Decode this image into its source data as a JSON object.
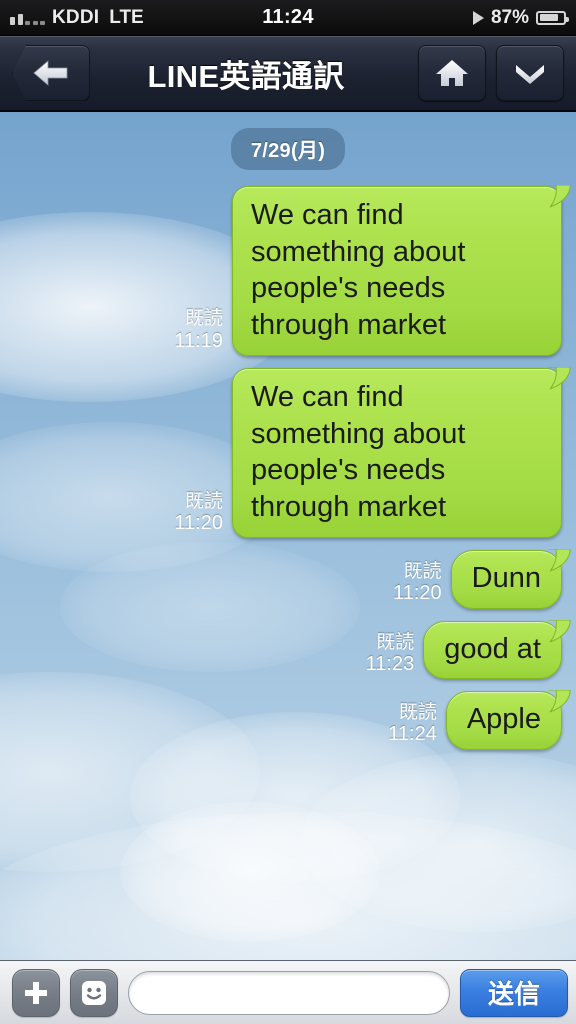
{
  "status_bar": {
    "signal_icon": "signal-bars-icon",
    "carrier": "KDDI",
    "network": "LTE",
    "time": "11:24",
    "play_icon": "play-triangle-icon",
    "battery_percent": "87%",
    "battery_icon": "battery-icon",
    "battery_level": 87
  },
  "navbar": {
    "back_icon": "arrow-left-icon",
    "title": "LINE英語通訳",
    "home_icon": "home-icon",
    "chevron_icon": "chevron-down-icon"
  },
  "chat": {
    "date_label": "7/29(月)",
    "messages": [
      {
        "text": "We can find something about people's needs through market",
        "read_label": "既読",
        "time": "11:19",
        "size": "large"
      },
      {
        "text": "We can find something about people's needs through market",
        "read_label": "既読",
        "time": "11:20",
        "size": "large"
      },
      {
        "text": "Dunn",
        "read_label": "既読",
        "time": "11:20",
        "size": "small"
      },
      {
        "text": "good at",
        "read_label": "既読",
        "time": "11:23",
        "size": "small"
      },
      {
        "text": "Apple",
        "read_label": "既読",
        "time": "11:24",
        "size": "small"
      }
    ]
  },
  "input_bar": {
    "plus_icon": "plus-icon",
    "emoji_icon": "smiley-face-icon",
    "message_value": "",
    "message_placeholder": "",
    "send_label": "送信"
  },
  "colors": {
    "bubble_green": "#a8e24a",
    "send_blue": "#2a6dd2",
    "navbar_dark": "#222838",
    "sky_blue": "#8cb4d6"
  }
}
